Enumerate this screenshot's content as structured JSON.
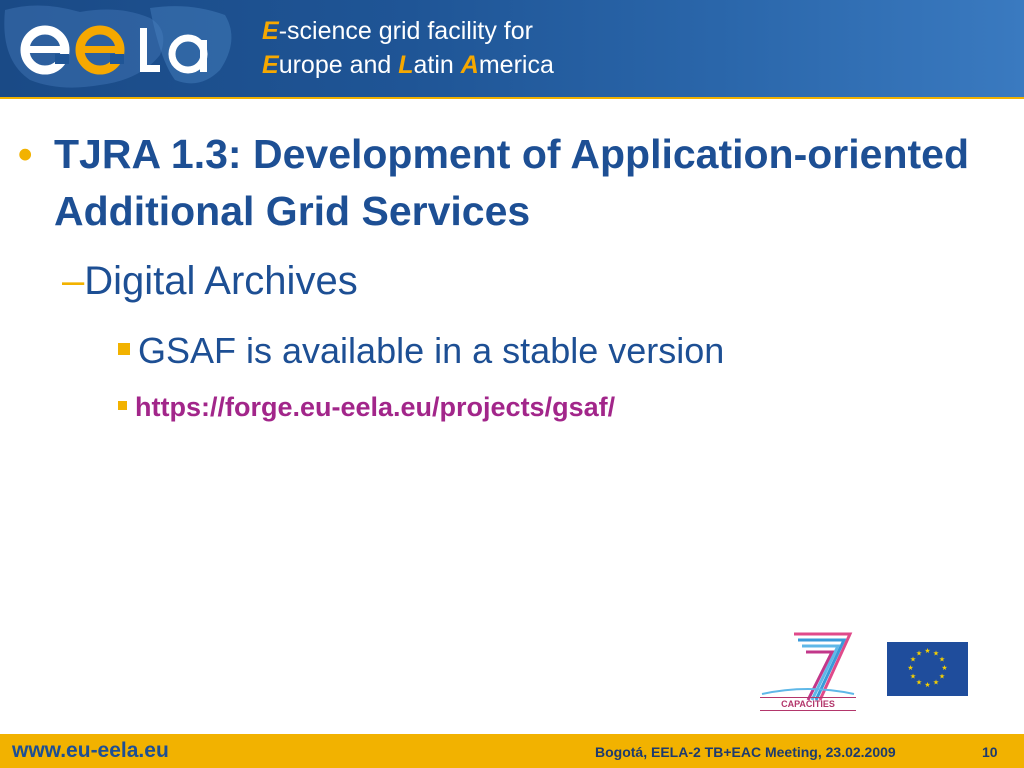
{
  "header": {
    "logo_label": "eela",
    "line1_accent": "E",
    "line1_rest": "-science grid facility for",
    "line2_e": "E",
    "line2_a": "urope and ",
    "line2_l": "L",
    "line2_b": "atin ",
    "line2_am": "A",
    "line2_c": "merica"
  },
  "slide": {
    "level1": "TJRA 1.3: Development of Application-oriented Additional Grid Services",
    "level2_dash": "–",
    "level2": "Digital Archives",
    "level3": "GSAF is available in a stable version",
    "level4": "https://forge.eu-eela.eu/projects/gsaf/"
  },
  "logos": {
    "fp7_caption": "CAPACITIES"
  },
  "footer": {
    "website": "www.eu-eela.eu",
    "meeting": "Bogotá, EELA-2 TB+EAC Meeting, 23.02.2009",
    "page_number": "10"
  },
  "colors": {
    "header_blue": "#1f5596",
    "text_blue": "#1d4f94",
    "accent_yellow": "#f2b200",
    "link_purple": "#a2268a"
  }
}
